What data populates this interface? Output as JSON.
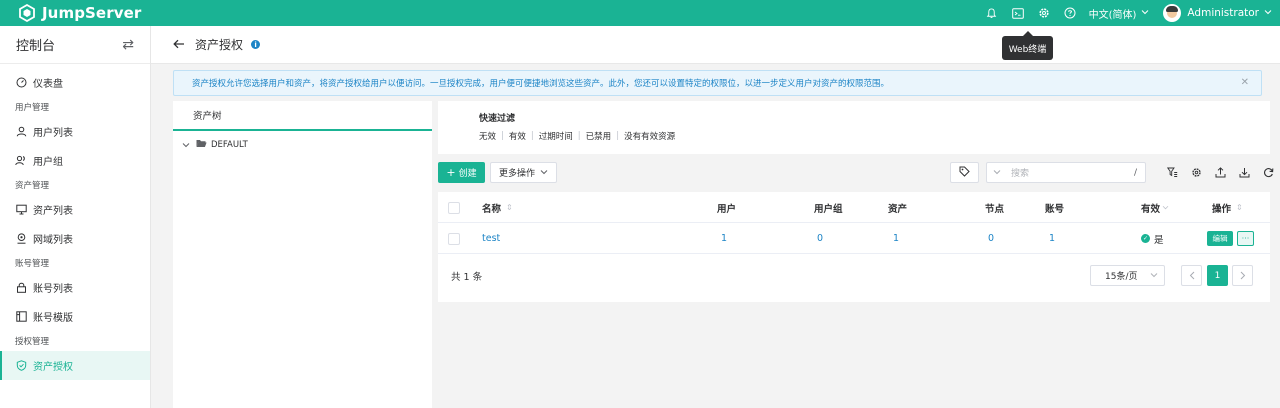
{
  "topbar": {
    "app_name": "JumpServer",
    "language": "中文(简体)",
    "user_name": "Administrator",
    "tooltip": "Web终端",
    "brand_color": "#1ab394"
  },
  "sidebar": {
    "title": "控制台",
    "dashboard": "仪表盘",
    "groups": {
      "user_mgmt": "用户管理",
      "asset_mgmt": "资产管理",
      "account_mgmt": "账号管理",
      "perm_mgmt": "授权管理"
    },
    "items": {
      "user_list": "用户列表",
      "user_group": "用户组",
      "asset_list": "资产列表",
      "domain_list": "网域列表",
      "account_list": "账号列表",
      "account_template": "账号模版",
      "asset_perm": "资产授权"
    }
  },
  "page": {
    "title": "资产授权",
    "alert": "资产授权允许您选择用户和资产，将资产授权给用户以便访问。一旦授权完成，用户便可便捷地浏览这些资产。此外，您还可以设置特定的权限位，以进一步定义用户对资产的权限范围。"
  },
  "tree": {
    "title": "资产树",
    "root": "DEFAULT"
  },
  "filter": {
    "title": "快速过滤",
    "options": [
      "无效",
      "有效",
      "过期时间",
      "已禁用",
      "没有有效资源"
    ]
  },
  "toolbar": {
    "create": "创建",
    "more": "更多操作",
    "search_placeholder": "搜索",
    "search_shortcut": "/"
  },
  "table": {
    "headers": {
      "name": "名称",
      "users": "用户",
      "user_groups": "用户组",
      "assets": "资产",
      "nodes": "节点",
      "accounts": "账号",
      "valid": "有效",
      "actions": "操作"
    },
    "rows": [
      {
        "name": "test",
        "users": "1",
        "user_groups": "0",
        "assets": "1",
        "nodes": "0",
        "accounts": "1",
        "valid": "是",
        "edit": "编辑",
        "more": "···"
      }
    ]
  },
  "pagination": {
    "total": "共 1 条",
    "page_size": "15条/页",
    "current": "1"
  }
}
